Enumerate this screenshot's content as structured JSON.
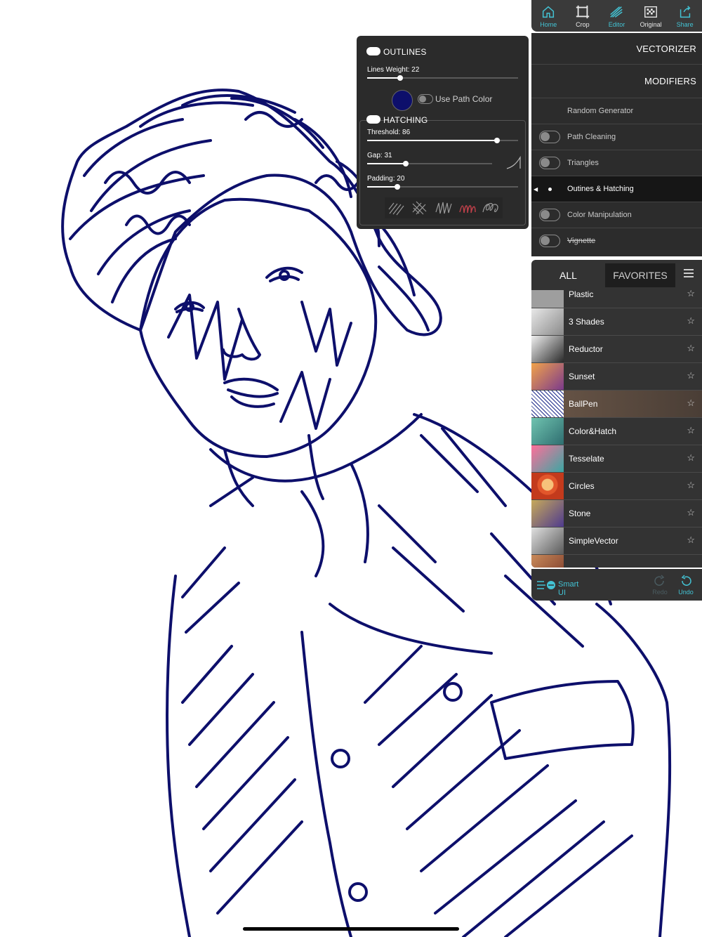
{
  "toolbar": {
    "items": [
      {
        "label": "Home",
        "icon": "home-icon"
      },
      {
        "label": "Crop",
        "icon": "crop-icon"
      },
      {
        "label": "Editor",
        "icon": "editor-icon"
      },
      {
        "label": "Original",
        "icon": "original-icon"
      },
      {
        "label": "Share",
        "icon": "share-icon"
      }
    ]
  },
  "modifiers_panel": {
    "vectorizer": "VECTORIZER",
    "modifiers": "MODIFIERS",
    "random_generator": "Random Generator",
    "items": [
      {
        "label": "Path Cleaning",
        "enabled": false
      },
      {
        "label": "Triangles",
        "enabled": false
      },
      {
        "label": "Outines & Hatching",
        "active": true
      },
      {
        "label": "Color Manipulation",
        "enabled": false
      },
      {
        "label": "Vignette",
        "enabled": false
      }
    ]
  },
  "outlines_popup": {
    "outlines_title": "OUTLINES",
    "lines_weight_label": "Lines Weight: 22",
    "lines_weight": 0.22,
    "path_color": "#0d0f6b",
    "use_path_color_label": "Use Path Color",
    "hatching_title": "HATCHING",
    "threshold_label": "Threshold: 86",
    "threshold": 0.86,
    "gap_label": "Gap: 31",
    "gap": 0.31,
    "padding_label": "Padding: 20",
    "padding": 0.2,
    "hatch_styles": [
      "diagonal-hatch-icon",
      "cross-hatch-icon",
      "zigzag-hatch-icon",
      "scribble-hatch-icon",
      "loop-hatch-icon"
    ],
    "selected_style_color": "#c0404a"
  },
  "presets": {
    "tab_all": "ALL",
    "tab_favorites": "FAVORITES",
    "items": [
      {
        "name": "Plastic"
      },
      {
        "name": "3 Shades"
      },
      {
        "name": "Reductor"
      },
      {
        "name": "Sunset"
      },
      {
        "name": "BallPen",
        "selected": true
      },
      {
        "name": "Color&Hatch"
      },
      {
        "name": "Tesselate"
      },
      {
        "name": "Circles"
      },
      {
        "name": "Stone"
      },
      {
        "name": "SimpleVector"
      }
    ]
  },
  "bottom_bar": {
    "smart_ui": "Smart UI",
    "redo": "Redo",
    "undo": "Undo"
  },
  "colors": {
    "ink": "#0d0f6b",
    "accent": "#43c3d4",
    "panel": "#2c2c2c"
  }
}
